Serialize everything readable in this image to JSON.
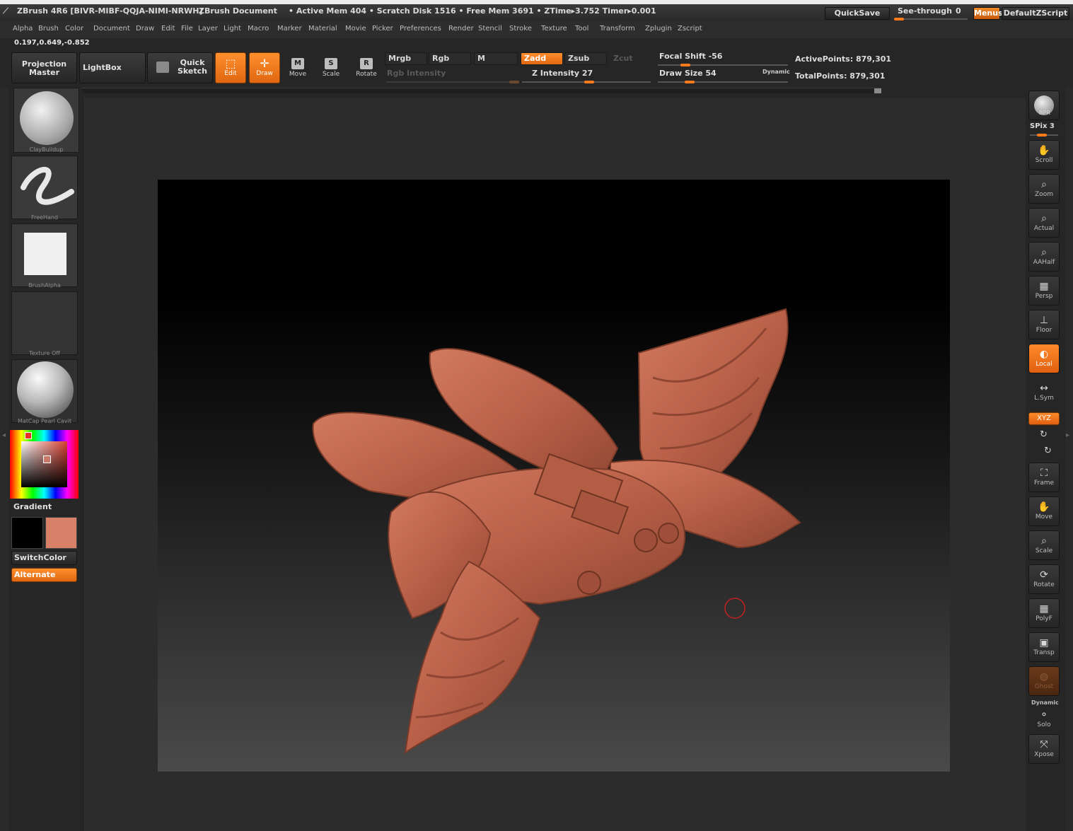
{
  "titlebar": {
    "app": "ZBrush 4R6 [BIVR-MIBF-QQJA-NIMI-NRWH]",
    "document": "ZBrush Document",
    "stats": "• Active Mem 404 • Scratch Disk 1516 • Free Mem 3691 • ZTime▸3.752 Timer▸0.001",
    "quicksave": "QuickSave",
    "seethrough": "See-through",
    "seethrough_value": "0",
    "menus": "Menus",
    "script": "DefaultZScript"
  },
  "menubar": [
    "Alpha",
    "Brush",
    "Color",
    "Document",
    "Draw",
    "Edit",
    "File",
    "Layer",
    "Light",
    "Macro",
    "Marker",
    "Material",
    "Movie",
    "Picker",
    "Preferences",
    "Render",
    "Stencil",
    "Stroke",
    "Texture",
    "Tool",
    "Transform",
    "Zplugin",
    "Zscript"
  ],
  "coords": "0.197,0.649,-0.852",
  "toolbar": {
    "projection_master": "Projection Master",
    "lightbox": "LightBox",
    "quick_sketch": "Quick Sketch",
    "edit": "Edit",
    "draw": "Draw",
    "move": "Move",
    "scale": "Scale",
    "rotate": "Rotate",
    "mrgb": "Mrgb",
    "rgb": "Rgb",
    "m": "M",
    "zadd": "Zadd",
    "zsub": "Zsub",
    "zcut": "Zcut",
    "rgb_intensity": "Rgb Intensity",
    "z_intensity": "Z Intensity 27",
    "focal_shift": "Focal Shift -56",
    "draw_size": "Draw Size 54",
    "dynamic": "Dynamic",
    "active_points": "ActivePoints: 879,301",
    "total_points": "TotalPoints: 879,301"
  },
  "left_shelf": {
    "brush": "ClayBuildup",
    "stroke": "FreeHand",
    "alpha": "BrushAlpha",
    "texture": "Texture Off",
    "material": "MatCap Pearl Cavit",
    "gradient": "Gradient",
    "switch_color": "SwitchColor",
    "alternate": "Alternate",
    "main_color": "#000000",
    "secondary_color": "#d98068"
  },
  "right_shelf": {
    "bpr": "BPR",
    "spix": "SPix 3",
    "scroll": "Scroll",
    "zoom": "Zoom",
    "actual": "Actual",
    "aahalf": "AAHalf",
    "persp": "Persp",
    "floor": "Floor",
    "local": "Local",
    "lsym": "L.Sym",
    "xyz": "XYZ",
    "frame": "Frame",
    "move": "Move",
    "scale": "Scale",
    "rotate": "Rotate",
    "polyf": "PolyF",
    "transp": "Transp",
    "ghost": "Ghost",
    "dynamic": "Dynamic",
    "solo": "Solo",
    "xpose": "Xpose"
  },
  "colors": {
    "accent": "#ff7a18",
    "model": "#c46a52"
  }
}
